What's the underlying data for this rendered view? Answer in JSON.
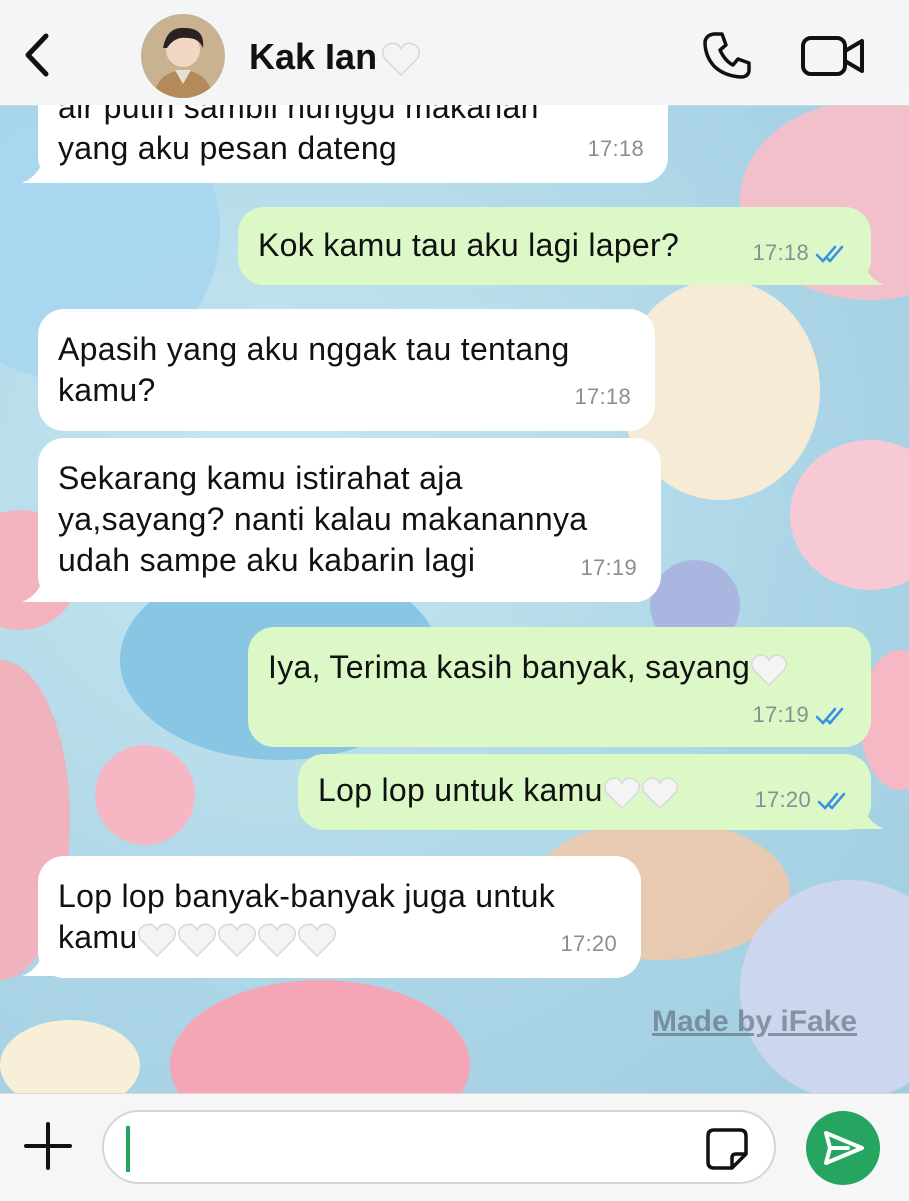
{
  "header": {
    "contact_name": "Kak Ian",
    "contact_emoji": "🤍"
  },
  "messages": [
    {
      "direction": "in",
      "text_lines": [
        "air putih sambil nunggu makanan",
        "yang aku pesan dateng"
      ],
      "time": "17:18"
    },
    {
      "direction": "out",
      "text": "Kok kamu tau aku lagi laper?",
      "time": "17:18",
      "read": true
    },
    {
      "direction": "in",
      "text_lines": [
        "Apasih yang aku nggak tau tentang",
        "kamu?"
      ],
      "time": "17:18"
    },
    {
      "direction": "in",
      "text_lines": [
        "Sekarang kamu istirahat aja",
        "ya,sayang? nanti kalau makanannya",
        "udah sampe aku kabarin lagi"
      ],
      "time": "17:19"
    },
    {
      "direction": "out",
      "text": "Iya, Terima kasih banyak, sayang",
      "emoji": "🤍",
      "time": "17:19",
      "read": true
    },
    {
      "direction": "out",
      "text": "Lop lop untuk kamu",
      "emoji": "🤍🤍",
      "time": "17:20",
      "read": true
    },
    {
      "direction": "in",
      "text_lines": [
        "Lop lop banyak-banyak juga untuk",
        "kamu"
      ],
      "emoji": "🤍🤍🤍🤍🤍",
      "time": "17:20"
    }
  ],
  "watermark": "Made by iFake",
  "colors": {
    "incoming_bubble": "#ffffff",
    "outgoing_bubble": "#dbf8c6",
    "accent_green": "#25a55f",
    "read_ticks": "#3b8fe8"
  },
  "icons": [
    "back-chevron-icon",
    "voice-call-icon",
    "video-call-icon",
    "plus-icon",
    "sticker-icon",
    "send-icon"
  ]
}
